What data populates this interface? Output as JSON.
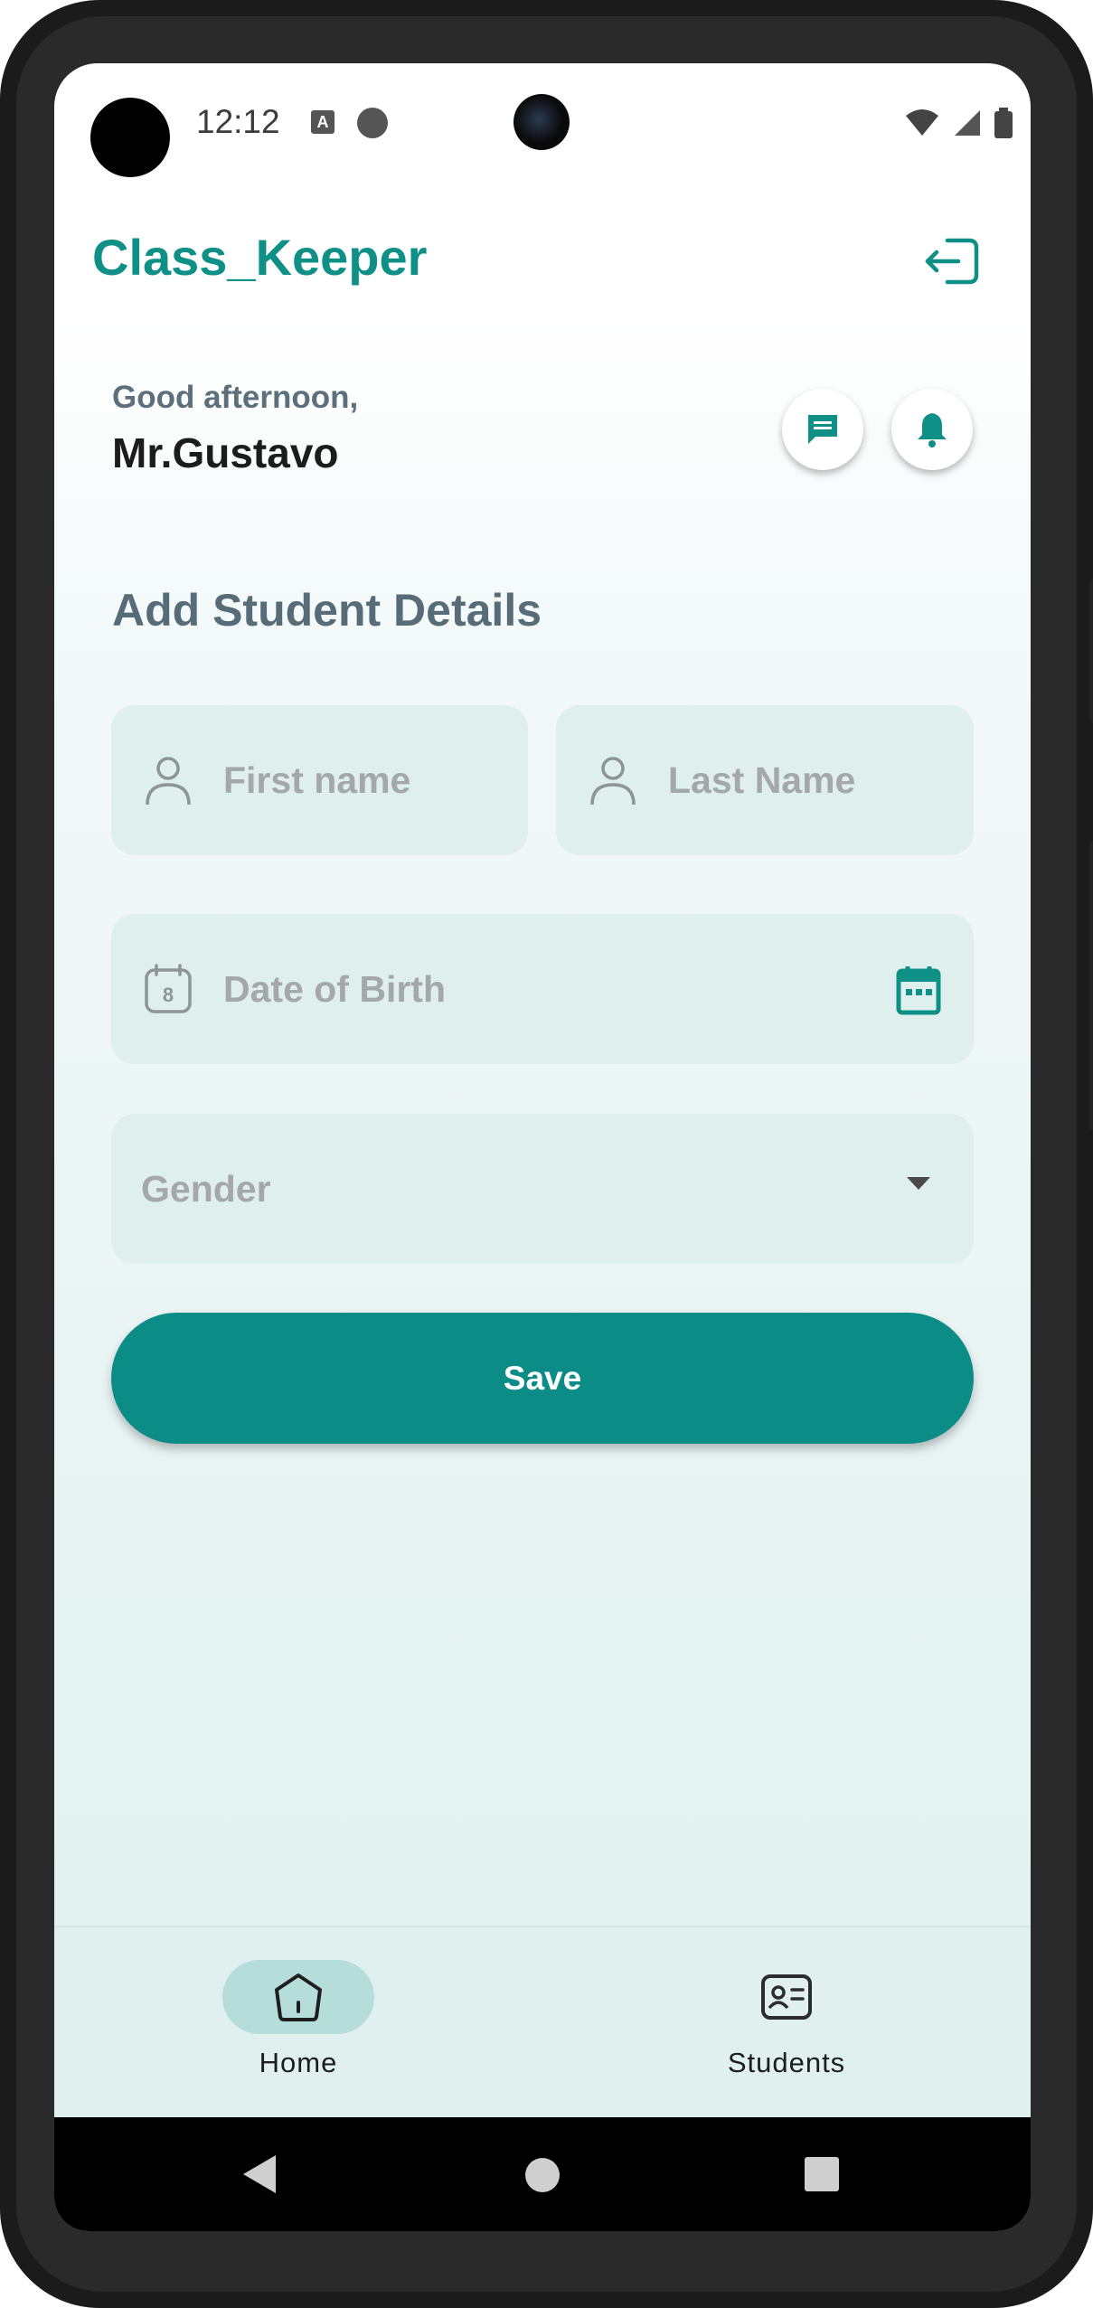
{
  "status_bar": {
    "time": "12:12"
  },
  "app_bar": {
    "title": "Class_Keeper"
  },
  "greeting": {
    "salutation": "Good afternoon,",
    "name": "Mr.Gustavo"
  },
  "form": {
    "title": "Add Student Details",
    "first_name": {
      "placeholder": "First name",
      "icon": "person-icon"
    },
    "last_name": {
      "placeholder": "Last Name",
      "icon": "person-icon"
    },
    "dob": {
      "placeholder": "Date of Birth",
      "icon": "calendar-icon",
      "picker_icon": "calendar-picker-icon",
      "calendar_day": "8"
    },
    "gender": {
      "placeholder": "Gender",
      "icon": "dropdown-arrow-icon"
    },
    "save_label": "Save"
  },
  "bottom_nav": {
    "items": [
      {
        "label": "Home",
        "icon": "home-icon",
        "active": true
      },
      {
        "label": "Students",
        "icon": "id-card-icon",
        "active": false
      }
    ]
  },
  "colors": {
    "brand": "#0e9087",
    "button": "#0c8c86",
    "field_bg": "#dfefee",
    "nav_active_pill": "#b5dedb"
  }
}
